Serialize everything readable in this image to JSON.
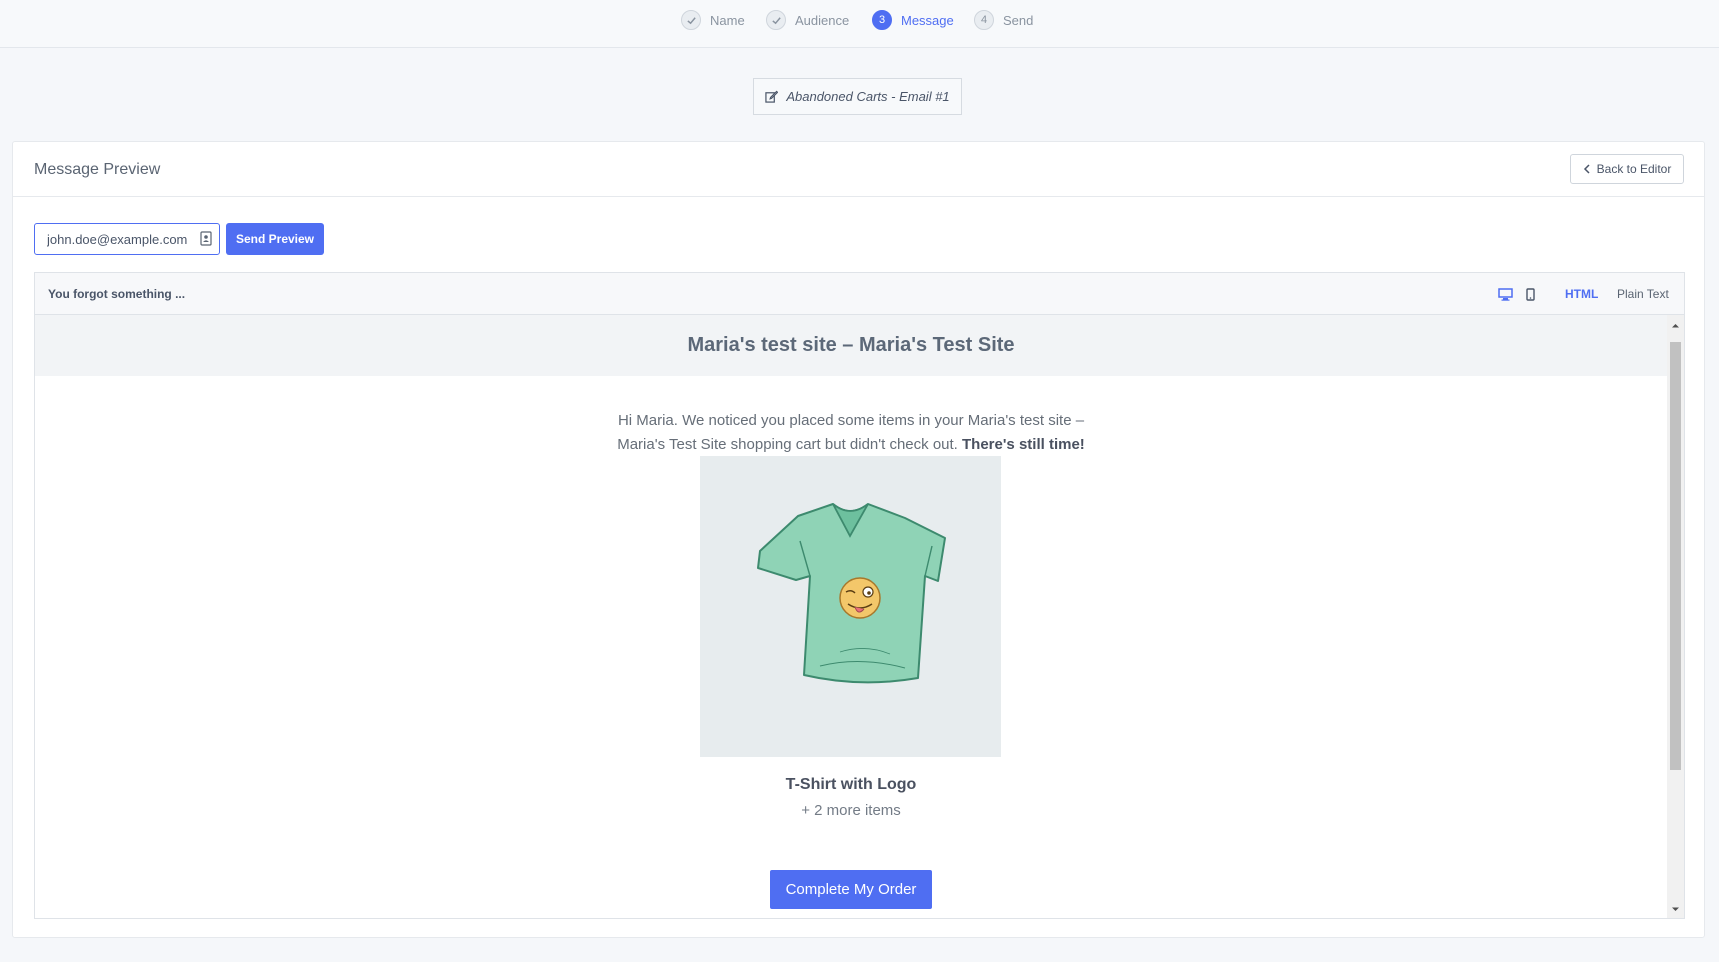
{
  "wizard": {
    "steps": [
      {
        "number": "1",
        "label": "Name",
        "state": "done"
      },
      {
        "number": "2",
        "label": "Audience",
        "state": "done"
      },
      {
        "number": "3",
        "label": "Message",
        "state": "active"
      },
      {
        "number": "4",
        "label": "Send",
        "state": "pending"
      }
    ]
  },
  "campaign": {
    "name": "Abandoned Carts - Email #1",
    "icon": "edit-icon"
  },
  "panel": {
    "title": "Message Preview",
    "back_label": "Back to Editor"
  },
  "preview_form": {
    "email_value": "john.doe@example.com",
    "send_label": "Send Preview"
  },
  "preview": {
    "subject": "You forgot something ...",
    "devices": [
      "desktop-icon",
      "mobile-icon"
    ],
    "formats": {
      "html": "HTML",
      "plain": "Plain Text",
      "selected": "HTML"
    }
  },
  "email": {
    "header": "Maria's test site – Maria's Test Site",
    "intro_text": "Hi Maria. We noticed you placed some items in your Maria's test site – Maria's Test Site shopping cart but didn't check out.",
    "intro_bold": "There's still time!",
    "product_name": "T-Shirt with Logo",
    "more_items": "+ 2 more items",
    "cta_label": "Complete My Order"
  },
  "colors": {
    "accent": "#4f6ef2",
    "background": "#f5f7fa",
    "shirt": "#8fd3b6"
  }
}
